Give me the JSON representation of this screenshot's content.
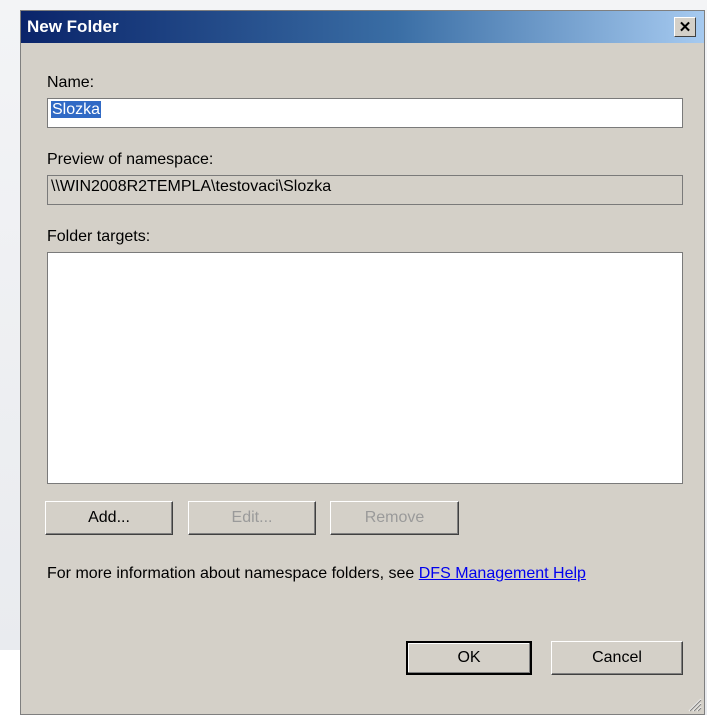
{
  "dialog": {
    "title": "New Folder",
    "close_icon": "close-icon"
  },
  "name": {
    "label": "Name:",
    "value": "Slozka"
  },
  "preview": {
    "label": "Preview of namespace:",
    "value": "\\\\WIN2008R2TEMPLA\\testovaci\\Slozka"
  },
  "targets": {
    "label": "Folder targets:",
    "items": []
  },
  "buttons": {
    "add": "Add...",
    "edit": "Edit...",
    "remove": "Remove",
    "ok": "OK",
    "cancel": "Cancel"
  },
  "info": {
    "text": "For more information about namespace folders, see ",
    "link": "DFS Management Help"
  }
}
